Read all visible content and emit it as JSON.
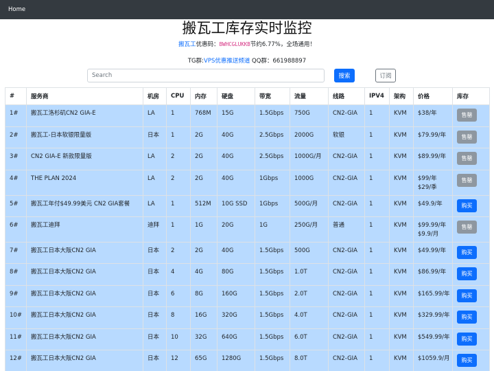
{
  "nav": {
    "home": "Home"
  },
  "header": {
    "title": "搬瓦工库存实时监控",
    "promo_link": "搬瓦工",
    "promo_text1": "优惠码：",
    "promo_code": "BWHCGLUKKB",
    "promo_text2": "节约6.77%，全场通用！",
    "tg_prefix": "TG群:",
    "tg_link": "VPS优惠推送频道",
    "qq_text": " QQ群：661988897"
  },
  "search": {
    "placeholder": "Search",
    "button": "搜索",
    "subscribe": "订阅"
  },
  "table": {
    "headers": [
      "#",
      "服务商",
      "机房",
      "CPU",
      "内存",
      "硬盘",
      "带宽",
      "流量",
      "线路",
      "IPV4",
      "架构",
      "价格",
      "库存"
    ],
    "rows": [
      {
        "id": "1#",
        "name": "搬瓦工洛杉矶CN2 GIA-E",
        "dc": "LA",
        "cpu": "1",
        "ram": "768M",
        "disk": "15G",
        "bw": "1.5Gbps",
        "traffic": "750G",
        "line": "CN2-GIA",
        "ipv4": "1",
        "arch": "KVM",
        "price": [
          "$38/年"
        ],
        "stock": "售罄",
        "status": "sold"
      },
      {
        "id": "2#",
        "name": "搬瓦工-日本软银限量版",
        "dc": "日本",
        "cpu": "1",
        "ram": "2G",
        "disk": "40G",
        "bw": "2.5Gbps",
        "traffic": "2000G",
        "line": "软银",
        "ipv4": "1",
        "arch": "KVM",
        "price": [
          "$79.99/年"
        ],
        "stock": "售罄",
        "status": "sold"
      },
      {
        "id": "3#",
        "name": "CN2 GIA-E 新款限量版",
        "dc": "LA",
        "cpu": "2",
        "ram": "2G",
        "disk": "40G",
        "bw": "2.5Gbps",
        "traffic": "1000G/月",
        "line": "CN2-GIA",
        "ipv4": "1",
        "arch": "KVM",
        "price": [
          "$89.99/年"
        ],
        "stock": "售罄",
        "status": "sold"
      },
      {
        "id": "4#",
        "name": "THE PLAN 2024",
        "dc": "LA",
        "cpu": "2",
        "ram": "2G",
        "disk": "40G",
        "bw": "1Gbps",
        "traffic": "1000G",
        "line": "CN2-GIA",
        "ipv4": "1",
        "arch": "KVM",
        "price": [
          "$99/年",
          "$29/季"
        ],
        "stock": "售罄",
        "status": "sold"
      },
      {
        "id": "5#",
        "name": "搬瓦工年付$49.99美元 CN2 GIA套餐",
        "dc": "LA",
        "cpu": "1",
        "ram": "512M",
        "disk": "10G SSD",
        "bw": "1Gbps",
        "traffic": "500G/月",
        "line": "CN2-GIA",
        "ipv4": "1",
        "arch": "KVM",
        "price": [
          "$49.9/年"
        ],
        "stock": "购买",
        "status": "buy"
      },
      {
        "id": "6#",
        "name": "搬瓦工迪拜",
        "dc": "迪拜",
        "cpu": "1",
        "ram": "1G",
        "disk": "20G",
        "bw": "1G",
        "traffic": "250G/月",
        "line": "普通",
        "ipv4": "1",
        "arch": "KVM",
        "price": [
          "$99.99/年",
          "$9.9/月"
        ],
        "stock": "售罄",
        "status": "sold"
      },
      {
        "id": "7#",
        "name": "搬瓦工日本大阪CN2 GIA",
        "dc": "日本",
        "cpu": "2",
        "ram": "2G",
        "disk": "40G",
        "bw": "1.5Gbps",
        "traffic": "500G",
        "line": "CN2-GIA",
        "ipv4": "1",
        "arch": "KVM",
        "price": [
          "$49.99/年"
        ],
        "stock": "购买",
        "status": "buy"
      },
      {
        "id": "8#",
        "name": "搬瓦工日本大阪CN2 GIA",
        "dc": "日本",
        "cpu": "4",
        "ram": "4G",
        "disk": "80G",
        "bw": "1.5Gbps",
        "traffic": "1.0T",
        "line": "CN2-GIA",
        "ipv4": "1",
        "arch": "KVM",
        "price": [
          "$86.99/年"
        ],
        "stock": "购买",
        "status": "buy"
      },
      {
        "id": "9#",
        "name": "搬瓦工日本大阪CN2 GIA",
        "dc": "日本",
        "cpu": "6",
        "ram": "8G",
        "disk": "160G",
        "bw": "1.5Gbps",
        "traffic": "2.0T",
        "line": "CN2-GIA",
        "ipv4": "1",
        "arch": "KVM",
        "price": [
          "$165.99/年"
        ],
        "stock": "购买",
        "status": "buy"
      },
      {
        "id": "10#",
        "name": "搬瓦工日本大阪CN2 GIA",
        "dc": "日本",
        "cpu": "8",
        "ram": "16G",
        "disk": "320G",
        "bw": "1.5Gbps",
        "traffic": "4.0T",
        "line": "CN2-GIA",
        "ipv4": "1",
        "arch": "KVM",
        "price": [
          "$329.99/年"
        ],
        "stock": "购买",
        "status": "buy"
      },
      {
        "id": "11#",
        "name": "搬瓦工日本大阪CN2 GIA",
        "dc": "日本",
        "cpu": "10",
        "ram": "32G",
        "disk": "640G",
        "bw": "1.5Gbps",
        "traffic": "6.0T",
        "line": "CN2-GIA",
        "ipv4": "1",
        "arch": "KVM",
        "price": [
          "$549.99/年"
        ],
        "stock": "购买",
        "status": "buy"
      },
      {
        "id": "12#",
        "name": "搬瓦工日本大阪CN2 GIA",
        "dc": "日本",
        "cpu": "12",
        "ram": "65G",
        "disk": "1280G",
        "bw": "1.5Gbps",
        "traffic": "8.0T",
        "line": "CN2-GIA",
        "ipv4": "1",
        "arch": "KVM",
        "price": [
          "$1059.9/月"
        ],
        "stock": "购买",
        "status": "buy"
      }
    ]
  }
}
